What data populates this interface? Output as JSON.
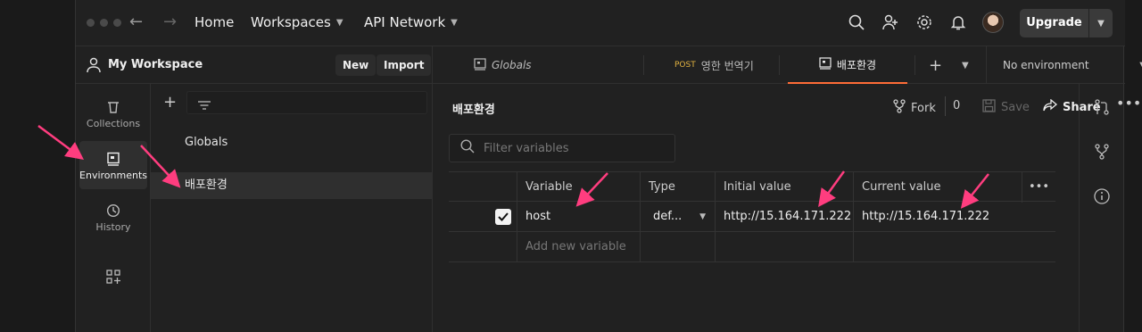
{
  "topbar": {
    "home": "Home",
    "workspaces": "Workspaces",
    "api_network": "API Network",
    "upgrade": "Upgrade",
    "icons": [
      "search-icon",
      "invite-user-icon",
      "settings-icon",
      "notification-icon"
    ]
  },
  "workspace": {
    "name": "My Workspace",
    "new_label": "New",
    "import_label": "Import"
  },
  "rail": {
    "items": [
      {
        "label": "Collections",
        "icon": "trash-icon"
      },
      {
        "label": "Environments",
        "icon": "environment-icon",
        "active": true
      },
      {
        "label": "History",
        "icon": "history-icon"
      },
      {
        "label": "",
        "icon": "add-apps-icon"
      }
    ]
  },
  "env_list": {
    "items": [
      "Globals",
      "배포환경"
    ],
    "selected": "배포환경"
  },
  "tabs": [
    {
      "label": "Globals",
      "method": ""
    },
    {
      "label": "영한 번역기",
      "method": "POST"
    },
    {
      "label": "배포환경",
      "method": "",
      "active": true
    }
  ],
  "env_selector": "No environment",
  "main": {
    "title": "배포환경",
    "fork_label": "Fork",
    "fork_count": "0",
    "save_label": "Save",
    "share_label": "Share",
    "filter_placeholder": "Filter variables",
    "columns": [
      "Variable",
      "Type",
      "Initial value",
      "Current value"
    ],
    "rows": [
      {
        "enabled": true,
        "variable": "host",
        "type": "def...",
        "initial": "http://15.164.171.222",
        "current": "http://15.164.171.222"
      }
    ],
    "add_placeholder": "Add new variable"
  },
  "colors": {
    "annotation_arrow": "#ff3d7f",
    "accent_tab": "#ff6c37",
    "post_method": "#e3b341"
  }
}
